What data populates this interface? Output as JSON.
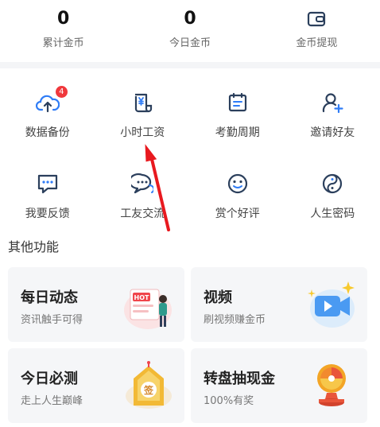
{
  "stats": [
    {
      "value": "0",
      "label": "累计金币"
    },
    {
      "value": "0",
      "label": "今日金币"
    },
    {
      "icon": "wallet-icon",
      "label": "金币提现"
    }
  ],
  "features": [
    {
      "label": "数据备份",
      "icon": "cloud-upload-icon",
      "badge": "4"
    },
    {
      "label": "小时工资",
      "icon": "yuan-scroll-icon"
    },
    {
      "label": "考勤周期",
      "icon": "calendar-icon"
    },
    {
      "label": "邀请好友",
      "icon": "add-user-icon"
    },
    {
      "label": "我要反馈",
      "icon": "feedback-chat-icon"
    },
    {
      "label": "工友交流",
      "icon": "chat-bubbles-icon"
    },
    {
      "label": "赏个好评",
      "icon": "smile-icon"
    },
    {
      "label": "人生密码",
      "icon": "yin-yang-icon"
    }
  ],
  "other_title": "其他功能",
  "cards": [
    {
      "title": "每日动态",
      "subtitle": "资讯触手可得",
      "icon": "hot-news-illustration",
      "illus_text": "HOT"
    },
    {
      "title": "视频",
      "subtitle": "刷视频赚金币",
      "icon": "video-camera-illustration"
    },
    {
      "title": "今日必测",
      "subtitle": "走上人生巅峰",
      "icon": "fortune-sign-illustration",
      "illus_text": "签"
    },
    {
      "title": "转盘抽现金",
      "subtitle": "100%有奖",
      "icon": "trophy-wheel-illustration"
    }
  ],
  "colors": {
    "icon": "#2b3f5c",
    "accent": "#2f7cf6",
    "badge": "#f0383c",
    "arrow": "#e8191f"
  }
}
